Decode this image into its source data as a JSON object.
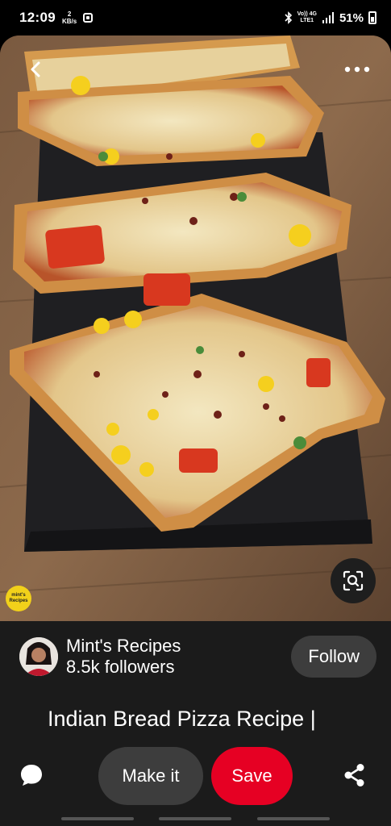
{
  "status_bar": {
    "time": "12:09",
    "speed_value": "2",
    "speed_unit": "KB/s",
    "network_top": "Vo)) 4G",
    "network_bottom": "LTE1",
    "battery": "51%"
  },
  "pin": {
    "watermark_text": "mint's Recipes",
    "icons": {
      "back": "back-arrow-icon",
      "more": "more-options-icon",
      "lens": "visual-search-icon"
    }
  },
  "creator": {
    "name": "Mint's Recipes",
    "followers": "8.5k followers",
    "follow_label": "Follow"
  },
  "title": "Indian Bread Pizza Recipe |",
  "actions": {
    "make_it_label": "Make it",
    "save_label": "Save"
  },
  "colors": {
    "save_red": "#e60023",
    "panel_bg": "#1b1b1b",
    "button_gray": "#3d3d3d"
  }
}
